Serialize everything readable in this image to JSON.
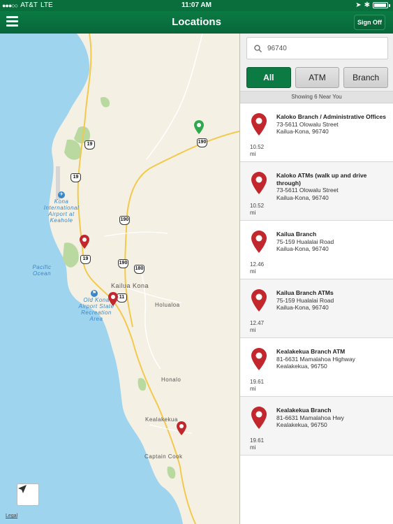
{
  "status_bar": {
    "signal": "●●●○○",
    "carrier": "AT&T",
    "network": "LTE",
    "time": "11:07 AM"
  },
  "nav": {
    "title": "Locations",
    "sign_off": "Sign Off",
    "menu_icon": "hamburger-icon"
  },
  "search": {
    "value": "96740",
    "icon": "search-icon"
  },
  "filters": [
    {
      "label": "All",
      "selected": true
    },
    {
      "label": "ATM",
      "selected": false
    },
    {
      "label": "Branch",
      "selected": false
    }
  ],
  "showing_text": "Showing 6 Near You",
  "locations": [
    {
      "name": "Kaloko Branch / Administrative Offices",
      "street": "73-5611 Olowalu Street",
      "city": "Kailua-Kona,  96740",
      "distance": "10.52",
      "unit": "mi"
    },
    {
      "name": "Kaloko ATMs (walk up and drive through)",
      "street": "73-5611 Olowalu Street",
      "city": "Kailua-Kona,  96740",
      "distance": "10.52",
      "unit": "mi"
    },
    {
      "name": "Kailua Branch",
      "street": "75-159 Hualalai Road",
      "city": "Kailua-Kona,  96740",
      "distance": "12.46",
      "unit": "mi"
    },
    {
      "name": "Kailua Branch ATMs",
      "street": "75-159 Hualalai Road",
      "city": "Kailua-Kona,  96740",
      "distance": "12.47",
      "unit": "mi"
    },
    {
      "name": "Kealakekua Branch ATM",
      "street": "81-6631 Mamalahoa Highway",
      "city": "Kealakekua,  96750",
      "distance": "19.61",
      "unit": "mi"
    },
    {
      "name": "Kealakekua Branch",
      "street": "81-6631 Mamalahoa Hwy",
      "city": "Kealakekua,  96750",
      "distance": "19.61",
      "unit": "mi"
    }
  ],
  "map": {
    "labels": {
      "airport": "Kona International Airport at Keahole",
      "ocean": "Pacific Ocean",
      "kailua_kona": "Kailua Kona",
      "holualoa": "Holualoa",
      "old_kona": "Old Kona Airport State Recreation Area",
      "honalo": "Honalo",
      "kealakekua": "Kealakekua",
      "captain_cook": "Captain Cook"
    },
    "routes": [
      "19",
      "190",
      "19",
      "190",
      "19",
      "190",
      "180",
      "11"
    ],
    "legal": "Legal",
    "locate_icon": "location-arrow-icon"
  },
  "colors": {
    "brand_green": "#0b7a43",
    "pin_red": "#c1272d",
    "pin_green": "#2fa84f",
    "ocean": "#9fd4ef",
    "land": "#f5f0e4",
    "park": "#b9d9a1"
  }
}
